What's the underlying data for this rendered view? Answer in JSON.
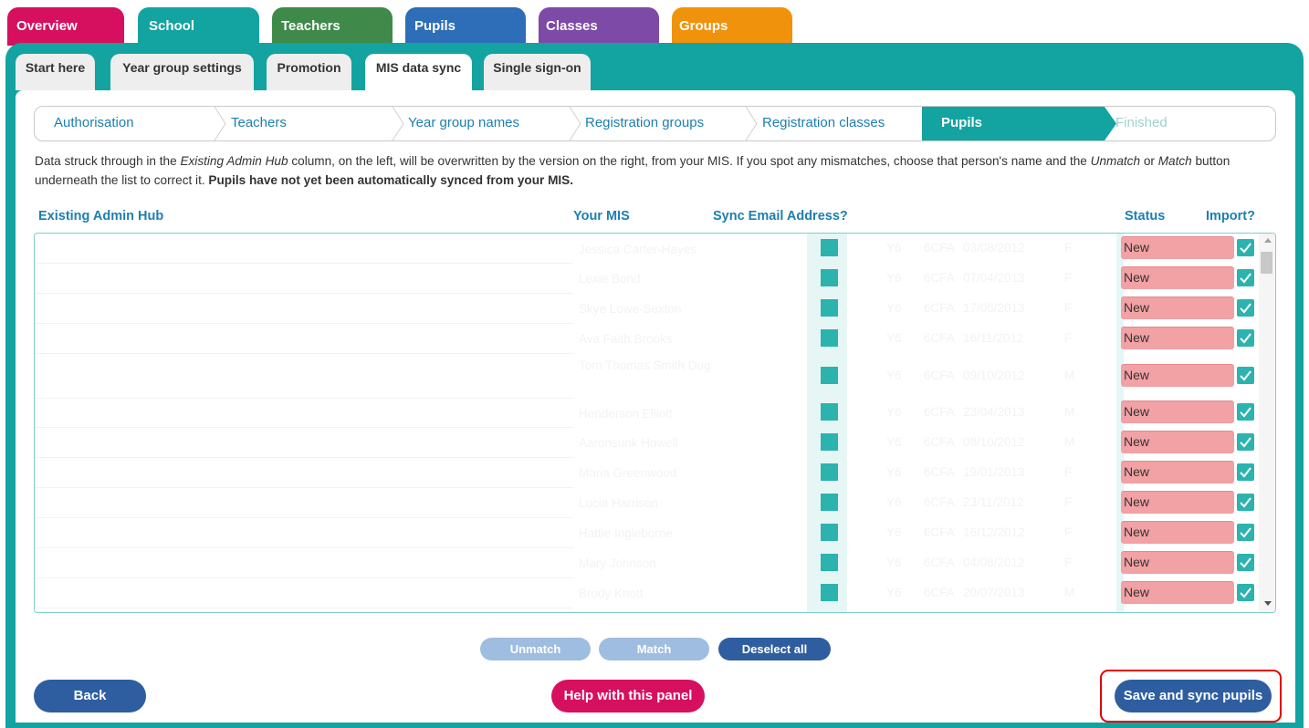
{
  "top_tabs": {
    "overview": "Overview",
    "school": "School",
    "teachers": "Teachers",
    "pupils": "Pupils",
    "classes": "Classes",
    "groups": "Groups"
  },
  "sub_tabs": {
    "start_here": "Start here",
    "year_group_settings": "Year group settings",
    "promotion": "Promotion",
    "mis_data_sync": "MIS data sync",
    "single_sign_on": "Single sign-on"
  },
  "steps": [
    "Authorisation",
    "Teachers",
    "Year group names",
    "Registration groups",
    "Registration classes",
    "Pupils",
    "Finished"
  ],
  "description": {
    "p1": "Data struck through in the ",
    "em1": "Existing Admin Hub",
    "p2": " column, on the left, will be overwritten by the version on the right, from your MIS. If you spot any mismatches, choose that person's name and the ",
    "em2": "Unmatch",
    "p3": " or ",
    "em3": "Match",
    "p4": " button underneath the list to correct it. ",
    "bold": "Pupils have not yet been automatically synced from your MIS."
  },
  "columns": {
    "existing": "Existing Admin Hub",
    "mis": "Your MIS",
    "sync_email": "Sync Email Address?",
    "status": "Status",
    "import": "Import?"
  },
  "rows": [
    {
      "name": "Jessica Carter-Hayes",
      "year": "Y6",
      "form": "6CFA",
      "dob": "03/08/2012",
      "gender": "F",
      "status": "New"
    },
    {
      "name": "Lexie Bond",
      "year": "Y6",
      "form": "6CFA",
      "dob": "07/04/2013",
      "gender": "F",
      "status": "New"
    },
    {
      "name": "Skye Lowe-Sexton",
      "year": "Y6",
      "form": "6CFA",
      "dob": "17/05/2013",
      "gender": "F",
      "status": "New"
    },
    {
      "name": "Ava Faith Brooks",
      "year": "Y6",
      "form": "6CFA",
      "dob": "16/11/2012",
      "gender": "F",
      "status": "New"
    },
    {
      "name": "Tom Thomas Smith Dug",
      "year": "Y6",
      "form": "6CFA",
      "dob": "09/10/2012",
      "gender": "M",
      "status": "New"
    },
    {
      "name": "Henderson Elliott",
      "year": "Y6",
      "form": "6CFA",
      "dob": "23/04/2013",
      "gender": "M",
      "status": "New"
    },
    {
      "name": "Aaronsunk Howell",
      "year": "Y6",
      "form": "6CFA",
      "dob": "08/10/2012",
      "gender": "M",
      "status": "New"
    },
    {
      "name": "Maria Greenwood",
      "year": "Y6",
      "form": "6CFA",
      "dob": "19/01/2013",
      "gender": "F",
      "status": "New"
    },
    {
      "name": "Lucia Harrison",
      "year": "Y6",
      "form": "6CFA",
      "dob": "23/11/2012",
      "gender": "F",
      "status": "New"
    },
    {
      "name": "Hattie Ingleborne",
      "year": "Y6",
      "form": "6CFA",
      "dob": "16/12/2012",
      "gender": "F",
      "status": "New"
    },
    {
      "name": "Mary Johnson",
      "year": "Y6",
      "form": "6CFA",
      "dob": "04/08/2012",
      "gender": "F",
      "status": "New"
    },
    {
      "name": "Brody Knott",
      "year": "Y6",
      "form": "6CFA",
      "dob": "20/07/2013",
      "gender": "M",
      "status": "New"
    }
  ],
  "buttons": {
    "unmatch": "Unmatch",
    "match": "Match",
    "deselect_all": "Deselect all",
    "back": "Back",
    "help": "Help with this panel",
    "save_sync": "Save and sync pupils"
  },
  "colors": {
    "teal": "#13a3a0",
    "link_blue": "#1c7fb0",
    "button_blue": "#2e5e9f",
    "magenta": "#d6105f",
    "status_new": "#f2a1a4",
    "highlight_red": "#e00000"
  }
}
